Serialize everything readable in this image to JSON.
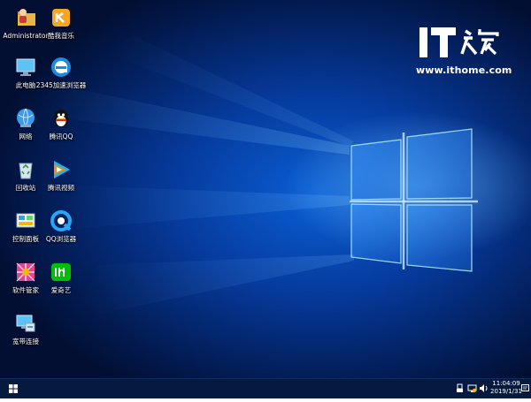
{
  "desktop": {
    "icons": [
      {
        "label": "Administrator",
        "icon": "user-folder-icon"
      },
      {
        "label": "酷我音乐",
        "icon": "kuwo-music-icon"
      },
      {
        "label": "此电脑",
        "icon": "this-pc-icon"
      },
      {
        "label": "2345加速浏览器",
        "icon": "2345-browser-icon"
      },
      {
        "label": "网络",
        "icon": "network-icon"
      },
      {
        "label": "腾讯QQ",
        "icon": "qq-penguin-icon"
      },
      {
        "label": "回收站",
        "icon": "recycle-bin-icon"
      },
      {
        "label": "腾讯视频",
        "icon": "tencent-video-icon"
      },
      {
        "label": "控制面板",
        "icon": "control-panel-icon"
      },
      {
        "label": "QQ浏览器",
        "icon": "qq-browser-icon"
      },
      {
        "label": "软件管家",
        "icon": "software-manager-icon"
      },
      {
        "label": "爱奇艺",
        "icon": "iqiyi-icon"
      },
      {
        "label": "宽带连接",
        "icon": "broadband-connection-icon"
      }
    ]
  },
  "watermark": {
    "logo_text": "IT之家",
    "url": "www.ithome.com"
  },
  "taskbar": {
    "start_icon": "windows-logo-icon",
    "tray_icons": [
      "usb-device-icon",
      "network-status-icon",
      "volume-icon",
      "notification-icon"
    ],
    "clock": {
      "time": "11:04:09",
      "date": "2019/1/31"
    }
  },
  "colors": {
    "taskbar_bg": "#061a40",
    "wallpaper_deep": "#031d57",
    "wallpaper_glow": "#0a5fd6",
    "text": "#ffffff"
  }
}
